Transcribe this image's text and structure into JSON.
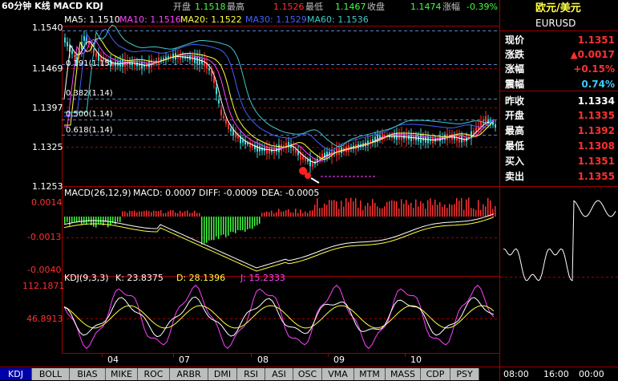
{
  "header": {
    "period_title": "60分钟 K线 MACD KDJ",
    "open_label": "开盘",
    "open": "1.1518",
    "high_label": "最高",
    "high": "1.1526",
    "low_label": "最低",
    "low": "1.1467",
    "close_label": "收盘",
    "close": "1.1474",
    "change_label": "涨幅",
    "change": "-0.39%"
  },
  "ma_line": {
    "ma5": "MA5: 1.1510",
    "ma10": "MA10: 1.1516",
    "ma20": "MA20: 1.1522",
    "ma30": "MA30: 1.1529",
    "ma60": "MA60: 1.1536"
  },
  "colors": {
    "up": "#ff3030",
    "down": "#40d8d8",
    "ma5": "#ffffff",
    "ma10": "#ff40ff",
    "ma20": "#ffff40",
    "ma30": "#4060ff",
    "ma60": "#40c8c8",
    "grid": "#a00000"
  },
  "price_axis": [
    "1.1540",
    "1.1469",
    "1.1397",
    "1.1325",
    "1.1253"
  ],
  "fib_levels": [
    "0.191(1.15)",
    "0.382(1.14)",
    "0.500(1.14)",
    "0.618(1.14)"
  ],
  "macd": {
    "title": "MACD(26,12,9)",
    "macd": "MACD: 0.0007",
    "diff": "DIFF: -0.0009",
    "dea": "DEA: -0.0005",
    "axis": [
      "0.0014",
      "-0.0013",
      "-0.0040"
    ]
  },
  "kdj": {
    "title": "KDJ(9,3,3)",
    "k": "K: 23.8375",
    "d": "D: 28.1396",
    "j": "J: 15.2333",
    "axis": [
      "112.1871",
      "46.8913"
    ]
  },
  "month_labels": [
    "04",
    "07",
    "08",
    "09",
    "10"
  ],
  "quote": {
    "name": "欧元/美元",
    "code": "EURUSD",
    "rows": [
      {
        "label": "现价",
        "value": "1.1351",
        "color": "#ff3030"
      },
      {
        "label": "涨跌",
        "value": "▲0.0017",
        "color": "#ff3030"
      },
      {
        "label": "涨幅",
        "value": "+0.15%",
        "color": "#ff3030"
      },
      {
        "label": "震幅",
        "value": "0.74%",
        "color": "#40c8ff"
      },
      {
        "label": "昨收",
        "value": "1.1334",
        "color": "#ffffff"
      },
      {
        "label": "开盘",
        "value": "1.1335",
        "color": "#ff3030"
      },
      {
        "label": "最高",
        "value": "1.1392",
        "color": "#ff3030"
      },
      {
        "label": "最低",
        "value": "1.1308",
        "color": "#ff3030"
      },
      {
        "label": "买入",
        "value": "1.1351",
        "color": "#ff3030"
      },
      {
        "label": "卖出",
        "value": "1.1355",
        "color": "#ff3030"
      }
    ]
  },
  "intraday_times": [
    "08:00",
    "16:00",
    "00:00"
  ],
  "tabs": [
    "KDJ",
    "BOLL",
    "BIAS",
    "MIKE",
    "ROC",
    "ARBR",
    "DMI",
    "RSI",
    "ASI",
    "OSC",
    "VMA",
    "MTM",
    "MASS",
    "CDP",
    "PSY"
  ]
}
